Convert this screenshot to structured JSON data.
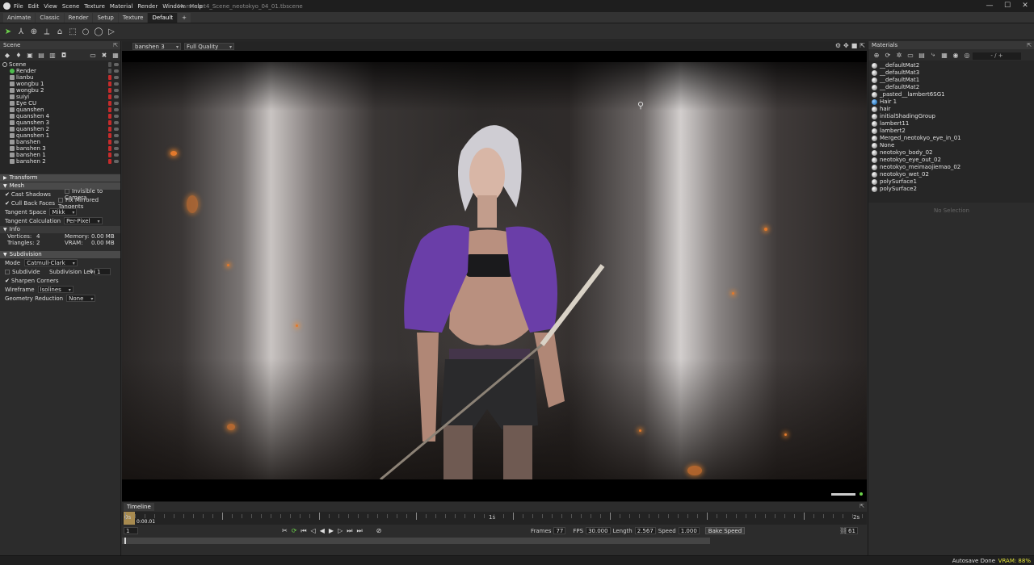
{
  "window": {
    "title": "Marmoset4_Scene_neotokyo_04_01.tbscene",
    "minimize": "—",
    "maximize": "☐",
    "close": "✕"
  },
  "menu": [
    "File",
    "Edit",
    "View",
    "Scene",
    "Texture",
    "Material",
    "Render",
    "Window",
    "Help"
  ],
  "tabs": [
    "Animate",
    "Classic",
    "Render",
    "Setup",
    "Texture",
    "Default",
    "+"
  ],
  "active_tab": "Default",
  "toolbar_icons": [
    "select-arrow-icon",
    "transform-icon",
    "rotate-icon",
    "scale-icon",
    "mesh-icon",
    "marquee-icon",
    "ellipse-icon",
    "lasso-icon",
    "paint-icon"
  ],
  "scene_panel": {
    "title": "Scene",
    "outliner": [
      {
        "label": "Scene",
        "icon": "scene",
        "root": true
      },
      {
        "label": "Render",
        "icon": "render",
        "lock": false
      },
      {
        "label": "lianbu",
        "icon": "mesh",
        "lock": true
      },
      {
        "label": "wongbu 1",
        "icon": "mesh",
        "lock": true
      },
      {
        "label": "wongbu 2",
        "icon": "mesh",
        "lock": true
      },
      {
        "label": "suiyi",
        "icon": "mesh",
        "lock": true
      },
      {
        "label": "Eye CU",
        "icon": "mesh",
        "lock": true
      },
      {
        "label": "quanshen",
        "icon": "mesh",
        "lock": true
      },
      {
        "label": "quanshen 4",
        "icon": "mesh",
        "lock": true
      },
      {
        "label": "quanshen 3",
        "icon": "mesh",
        "lock": true
      },
      {
        "label": "quanshen 2",
        "icon": "mesh",
        "lock": true
      },
      {
        "label": "quanshen 1",
        "icon": "mesh",
        "lock": true
      },
      {
        "label": "banshen",
        "icon": "mesh",
        "lock": true
      },
      {
        "label": "banshen 3",
        "icon": "mesh",
        "lock": true
      },
      {
        "label": "banshen 1",
        "icon": "mesh",
        "lock": true
      },
      {
        "label": "banshen 2",
        "icon": "mesh",
        "lock": true
      }
    ],
    "transform": "Transform",
    "mesh": {
      "title": "Mesh",
      "cast_shadows": "Cast Shadows",
      "invisible_to_camera": "Invisible to Camera",
      "cull_back_faces": "Cull Back Faces",
      "fix_mirrored": "Fix Mirrored Tangents",
      "tangent_space_label": "Tangent Space",
      "tangent_space": "Mikk",
      "tangent_calc_label": "Tangent Calculation",
      "tangent_calc": "Per-Pixel"
    },
    "info": {
      "title": "Info",
      "vertices_label": "Vertices:",
      "vertices": "4",
      "triangles_label": "Triangles:",
      "triangles": "2",
      "memory_label": "Memory:",
      "memory": "0.00 MB",
      "vram_label": "VRAM:",
      "vram": "0.00 MB"
    },
    "subdivision": {
      "title": "Subdivision",
      "mode_label": "Mode",
      "mode": "Catmull-Clark",
      "subdivide": "Subdivide",
      "level_label": "Subdivision Level",
      "level": "1",
      "sharpen": "Sharpen Corners",
      "wireframe_label": "Wireframe",
      "wireframe": "Isolines",
      "geo_reduction_label": "Geometry Reduction",
      "geo_reduction": "None"
    }
  },
  "viewport": {
    "camera": "banshen 3",
    "quality": "Full Quality",
    "icons": [
      "gear-icon",
      "move-icon",
      "square-icon",
      "fullscreen-icon"
    ]
  },
  "timeline": {
    "tab": "Timeline",
    "start_label": "0s",
    "mid_label": "1s",
    "end_label": "2s",
    "time": "0:00.01",
    "frame": "1",
    "frames_label": "Frames",
    "frames": "77",
    "fps_label": "FPS",
    "fps": "30.000",
    "length_label": "Length",
    "length": "2.567",
    "speed_label": "Speed",
    "speed": "1.000",
    "bake_label": "Bake Speed",
    "frame_count": "61",
    "transport": [
      "✂",
      "⟳",
      "⏮",
      "◁",
      "◀",
      "▶",
      "▷",
      "⏭",
      "⏭",
      "⊘"
    ]
  },
  "materials": {
    "title": "Materials",
    "counter": "- / +",
    "items": [
      {
        "name": "__defaultMat2",
        "blue": false
      },
      {
        "name": "__defaultMat3",
        "blue": false
      },
      {
        "name": "__defaultMat1",
        "blue": false
      },
      {
        "name": "__defaultMat2",
        "blue": false
      },
      {
        "name": "_pasted__lambert6SG1",
        "blue": false
      },
      {
        "name": "Hair 1",
        "blue": true
      },
      {
        "name": "hair",
        "blue": false
      },
      {
        "name": "initialShadingGroup",
        "blue": false
      },
      {
        "name": "lambert11",
        "blue": false
      },
      {
        "name": "lambert2",
        "blue": false
      },
      {
        "name": "Merged_neotokyo_eye_in_01",
        "blue": false
      },
      {
        "name": "None",
        "blue": false
      },
      {
        "name": "neotokyo_body_02",
        "blue": false
      },
      {
        "name": "neotokyo_eye_out_02",
        "blue": false
      },
      {
        "name": "neotokyo_meimaojiemao_02",
        "blue": false
      },
      {
        "name": "neotokyo_wet_02",
        "blue": false
      },
      {
        "name": "polySurface1",
        "blue": false
      },
      {
        "name": "polySurface2",
        "blue": false
      }
    ],
    "no_selection": "No Selection"
  },
  "status": {
    "autosave": "Autosave Done",
    "vram": "VRAM: 88%"
  }
}
